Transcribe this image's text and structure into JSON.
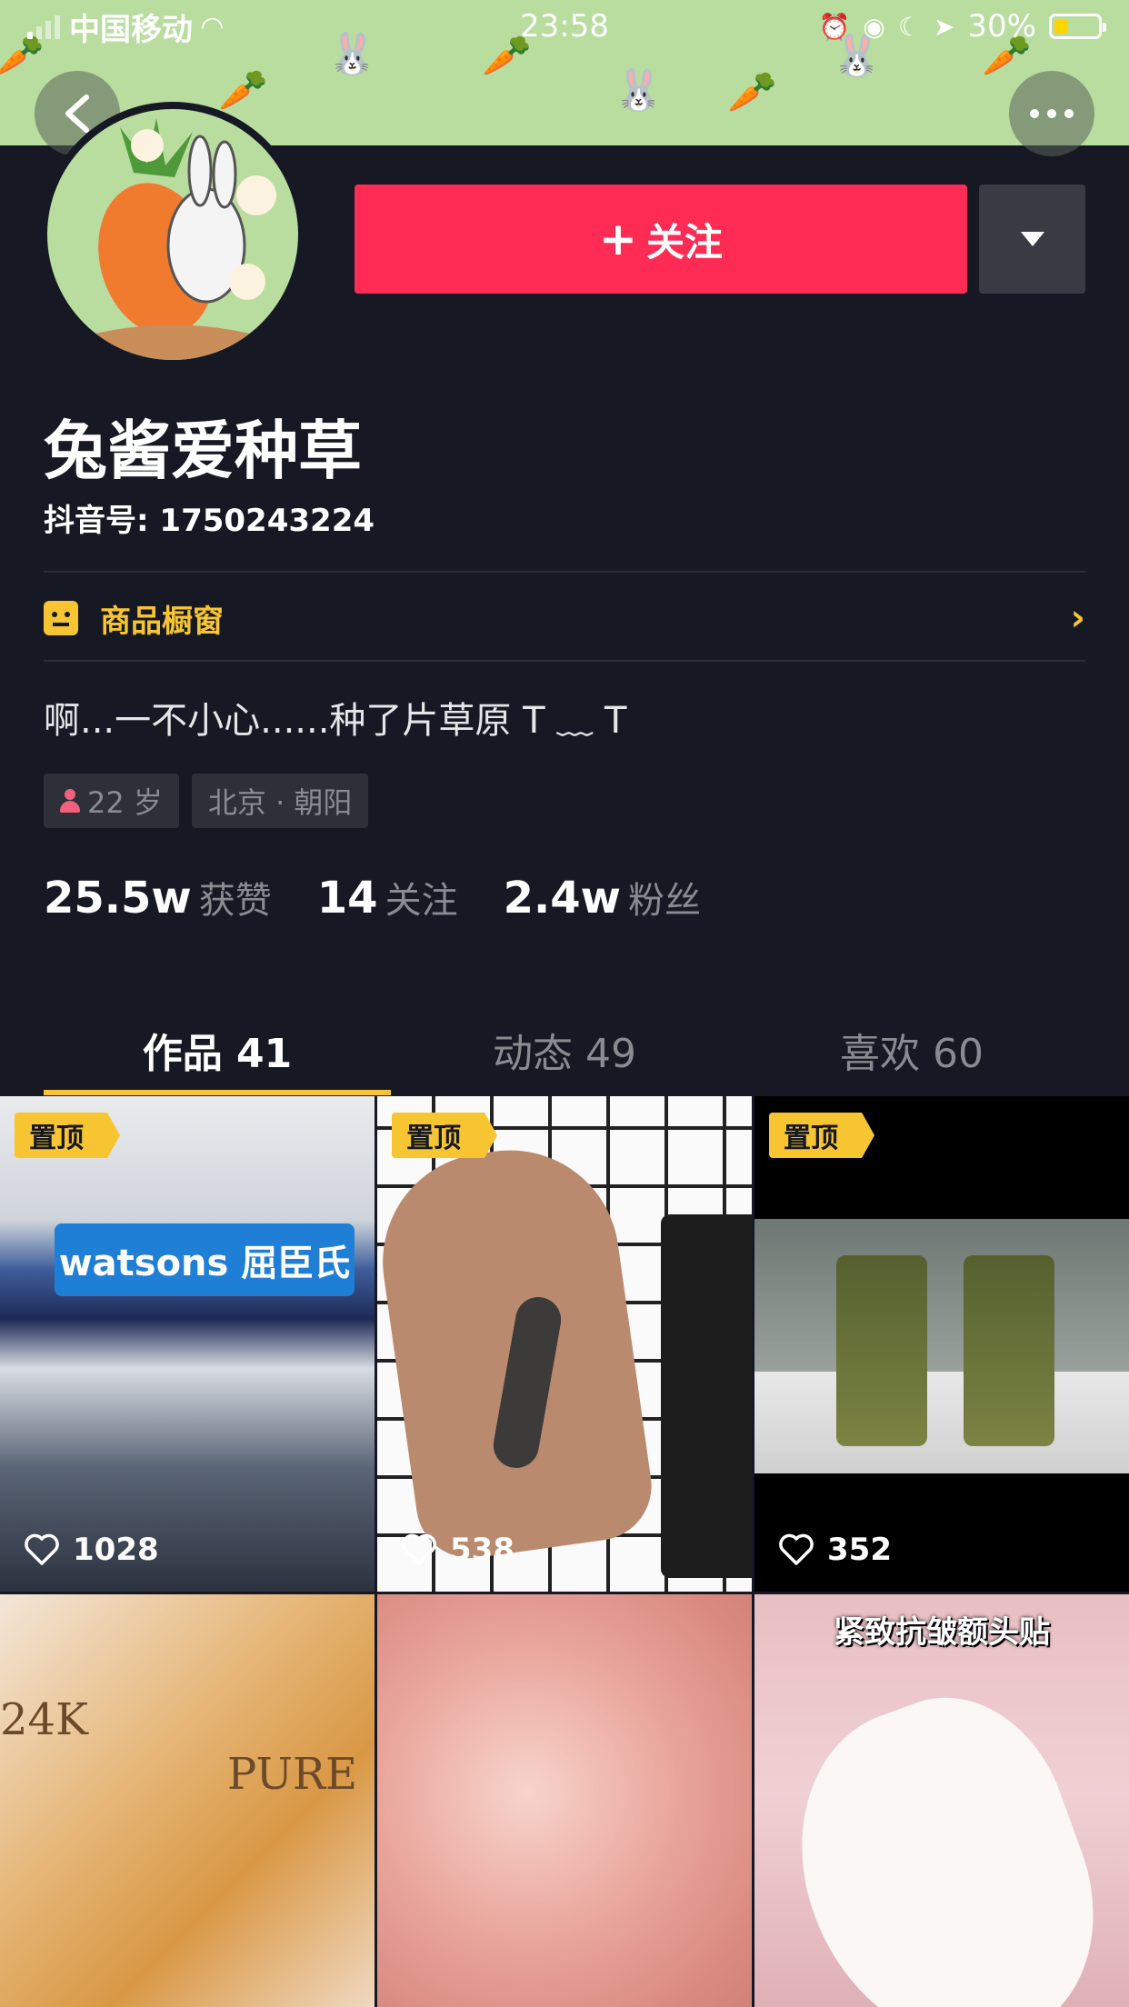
{
  "status_bar": {
    "carrier": "中国移动",
    "time": "23:58",
    "battery_percent": "30%"
  },
  "header": {
    "follow_label": "关注",
    "follow_plus": "+"
  },
  "profile": {
    "nickname": "兔酱爱种草",
    "douyin_id": "抖音号: 1750243224",
    "shop_label": "商品橱窗",
    "bio": "啊...一不小心......种了片草原 T ﹏ T",
    "age_tag": "22 岁",
    "location_tag": "北京 · 朝阳"
  },
  "stats": [
    {
      "num": "25.5w",
      "label": "获赞"
    },
    {
      "num": "14",
      "label": "关注"
    },
    {
      "num": "2.4w",
      "label": "粉丝"
    }
  ],
  "tabs": [
    {
      "label": "作品 41",
      "active": true
    },
    {
      "label": "动态 49",
      "active": false
    },
    {
      "label": "喜欢 60",
      "active": false
    }
  ],
  "videos": [
    {
      "pinned": "置顶",
      "likes": "1028",
      "shop_sign": "watsons 屈臣氏"
    },
    {
      "pinned": "置顶",
      "likes": "538"
    },
    {
      "pinned": "置顶",
      "likes": "352"
    },
    {
      "label_a": "24K",
      "label_b": "PURE"
    },
    {},
    {
      "caption": "紧致抗皱额头贴"
    }
  ],
  "colors": {
    "background": "#161823",
    "follow": "#fe2c55",
    "accent": "#f7c531",
    "banner": "#b9dc9f"
  },
  "icons": [
    "back-icon",
    "more-icon",
    "dropdown-icon",
    "shop-icon",
    "chevron-right-icon",
    "heart-icon",
    "female-icon"
  ]
}
